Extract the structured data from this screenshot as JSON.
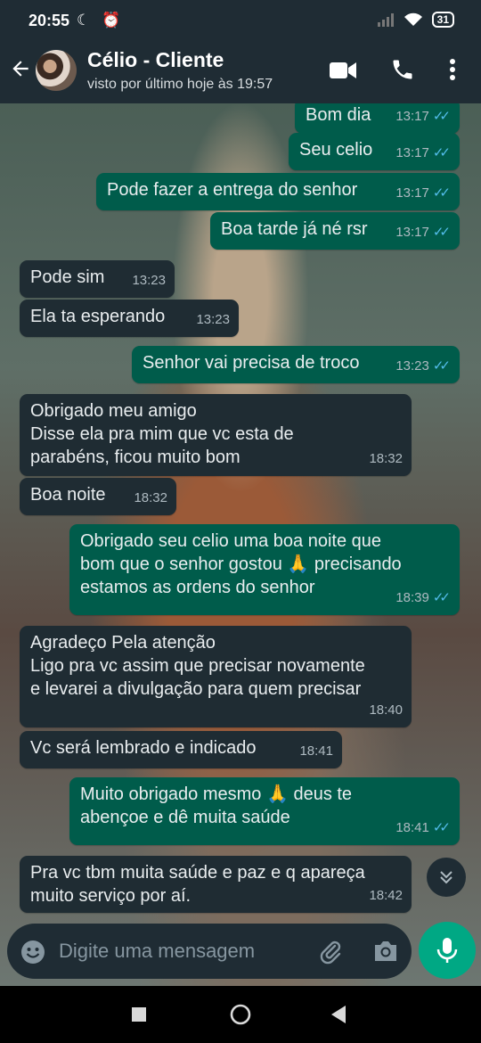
{
  "status_bar": {
    "time": "20:55",
    "left_icons": "☾ ⏰",
    "battery": "31"
  },
  "header": {
    "contact_name": "Célio - Cliente",
    "last_seen": "visto por último hoje às 19:57"
  },
  "messages": [
    {
      "dir": "out",
      "text": "Bom dia",
      "time": "13:17"
    },
    {
      "dir": "out",
      "text": "Seu celio",
      "time": "13:17"
    },
    {
      "dir": "out",
      "text": "Pode fazer a entrega do senhor",
      "time": "13:17"
    },
    {
      "dir": "out",
      "text": "Boa tarde já né rsr",
      "time": "13:17"
    },
    {
      "dir": "in",
      "text": "Pode sim",
      "time": "13:23"
    },
    {
      "dir": "in",
      "text": "Ela ta esperando",
      "time": "13:23"
    },
    {
      "dir": "out",
      "text": "Senhor vai precisa de troco",
      "time": "13:23"
    },
    {
      "dir": "in",
      "text": "Obrigado meu amigo\nDisse ela pra mim que vc esta de\nparabéns, ficou muito bom",
      "time": "18:32"
    },
    {
      "dir": "in",
      "text": "Boa noite",
      "time": "18:32"
    },
    {
      "dir": "out",
      "text": "Obrigado seu celio uma boa noite que\nbom que o senhor gostou 🙏 precisando\nestamos as ordens do senhor",
      "time": "18:39"
    },
    {
      "dir": "in",
      "text": "Agradeço Pela atenção\nLigo pra vc assim que precisar novamente\ne levarei a divulgação para quem precisar",
      "time": "18:40"
    },
    {
      "dir": "in",
      "text": "Vc será lembrado e indicado",
      "time": "18:41"
    },
    {
      "dir": "out",
      "text": "Muito obrigado mesmo 🙏 deus te\nabençoe e dê muita saúde",
      "time": "18:41"
    },
    {
      "dir": "in",
      "text": "Pra vc tbm muita saúde e paz e q apareça\nmuito serviço por aí.",
      "time": "18:42"
    }
  ],
  "input": {
    "placeholder": "Digite uma mensagem"
  },
  "colors": {
    "incoming": "#1f2c33",
    "outgoing": "#005c4b",
    "accent": "#00a884",
    "read_ticks": "#53bdeb"
  },
  "icons": [
    "back-arrow-icon",
    "video-call-icon",
    "phone-icon",
    "more-options-icon",
    "emoji-icon",
    "attach-icon",
    "camera-icon",
    "mic-icon",
    "scroll-down-icon"
  ]
}
